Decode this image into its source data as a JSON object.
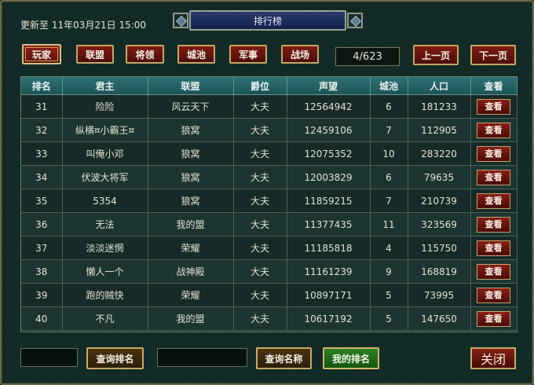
{
  "header": {
    "updated_text": "更新至  11年03月21日 15:00",
    "title": "排行榜"
  },
  "tabs": [
    {
      "label": "玩家",
      "active": true
    },
    {
      "label": "联盟",
      "active": false
    },
    {
      "label": "将领",
      "active": false
    },
    {
      "label": "城池",
      "active": false
    },
    {
      "label": "军事",
      "active": false
    },
    {
      "label": "战场",
      "active": false
    }
  ],
  "pager": {
    "page_indicator": "4/623",
    "prev_label": "上一页",
    "next_label": "下一页"
  },
  "table": {
    "columns": [
      "排名",
      "君主",
      "联盟",
      "爵位",
      "声望",
      "城池",
      "人口",
      "查看"
    ],
    "view_label": "查看",
    "rows": [
      {
        "rank": "31",
        "lord": "险险",
        "alliance": "风云天下",
        "title": "大夫",
        "prestige": "12564942",
        "cities": "6",
        "population": "181233"
      },
      {
        "rank": "32",
        "lord": "纵横¤小霸王¤",
        "alliance": "狼窝",
        "title": "大夫",
        "prestige": "12459106",
        "cities": "7",
        "population": "112905"
      },
      {
        "rank": "33",
        "lord": "叫俺小邓",
        "alliance": "狼窝",
        "title": "大夫",
        "prestige": "12075352",
        "cities": "10",
        "population": "283220"
      },
      {
        "rank": "34",
        "lord": "伏波大将军",
        "alliance": "狼窝",
        "title": "大夫",
        "prestige": "12003829",
        "cities": "6",
        "population": "79635"
      },
      {
        "rank": "35",
        "lord": "5354",
        "alliance": "狼窝",
        "title": "大夫",
        "prestige": "11859215",
        "cities": "7",
        "population": "210739"
      },
      {
        "rank": "36",
        "lord": "无法",
        "alliance": "我的盟",
        "title": "大夫",
        "prestige": "11377435",
        "cities": "11",
        "population": "323569"
      },
      {
        "rank": "37",
        "lord": "淡淡迷惘",
        "alliance": "荣耀",
        "title": "大夫",
        "prestige": "11185818",
        "cities": "4",
        "population": "115750"
      },
      {
        "rank": "38",
        "lord": "懒人一个",
        "alliance": "战神殿",
        "title": "大夫",
        "prestige": "11161239",
        "cities": "9",
        "population": "168819"
      },
      {
        "rank": "39",
        "lord": "跑的贼快",
        "alliance": "荣耀",
        "title": "大夫",
        "prestige": "10897171",
        "cities": "5",
        "population": "73995"
      },
      {
        "rank": "40",
        "lord": "不凡",
        "alliance": "我的盟",
        "title": "大夫",
        "prestige": "10617192",
        "cities": "5",
        "population": "147650"
      }
    ]
  },
  "footer": {
    "rank_input_value": "",
    "query_rank_label": "查询排名",
    "name_input_value": "",
    "query_name_label": "查询名称",
    "my_rank_label": "我的排名",
    "close_label": "关闭"
  },
  "colors": {
    "panel_bg": "#112a26",
    "header_teal": "#2f7275",
    "button_red": "#7f1c14",
    "button_border_gold": "#c2a865",
    "my_rank_green": "#2d7f22"
  }
}
